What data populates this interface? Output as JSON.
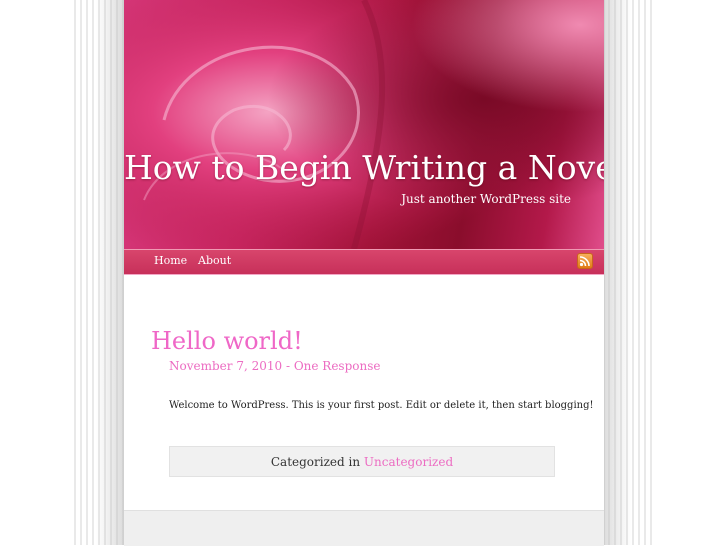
{
  "site": {
    "title": "How to Begin Writing a Novel",
    "description": "Just another WordPress site"
  },
  "nav": {
    "items": [
      {
        "label": "Home"
      },
      {
        "label": "About"
      }
    ],
    "feed_icon": "rss-feed-icon"
  },
  "post": {
    "title": "Hello world!",
    "date": "November 7, 2010",
    "separator": " - ",
    "comments": "One Response",
    "body": "Welcome to WordPress. This is your first post. Edit or delete it, then start blogging!",
    "categorized_prefix": "Categorized in ",
    "category": "Uncategorized"
  },
  "colors": {
    "accent": "#ec6cc2",
    "nav": "#c7305a",
    "header": "#a11338"
  }
}
